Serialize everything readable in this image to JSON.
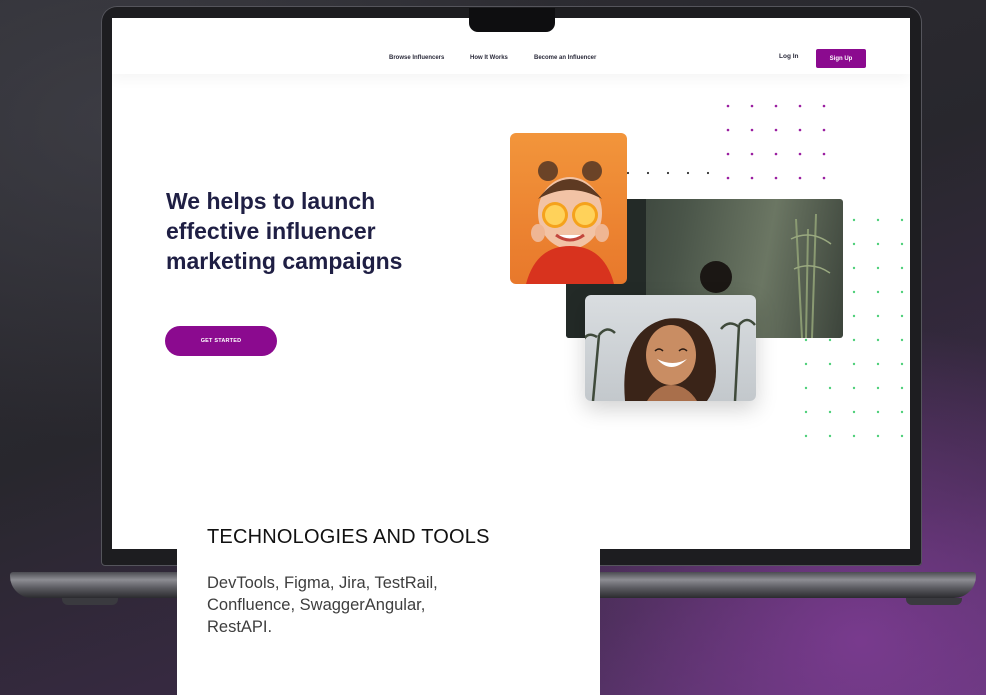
{
  "site": {
    "nav": {
      "browse": "Browse Influencers",
      "how": "How It Works",
      "become": "Become an Influencer"
    },
    "login": "Log In",
    "signup": "Sign Up",
    "hero": {
      "line1": "We helps to launch",
      "line2": "effective influencer",
      "line3": "marketing campaigns",
      "cta": "GET STARTED"
    }
  },
  "card": {
    "title": "TECHNOLOGIES AND TOOLS",
    "line1": "DevTools, Figma, Jira, TestRail,",
    "line2": "Confluence, SwaggerAngular,",
    "line3": "RestAPI."
  },
  "colors": {
    "brand_purple": "#8b0a8f",
    "headline_navy": "#1f1f44",
    "dot_purple": "#9a1ea0",
    "dot_green": "#4fd07a"
  }
}
